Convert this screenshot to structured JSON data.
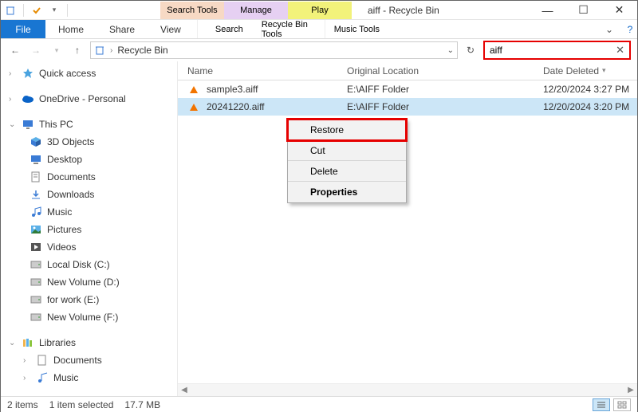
{
  "titlebar": {
    "tool_tabs": {
      "search": "Search Tools",
      "manage": "Manage",
      "play": "Play"
    },
    "title": "aiff - Recycle Bin"
  },
  "ribbon": {
    "file": "File",
    "tabs": [
      "Home",
      "Share",
      "View"
    ],
    "sub_tabs": [
      "Search",
      "Recycle Bin Tools",
      "Music Tools"
    ]
  },
  "address": {
    "crumb": "Recycle Bin"
  },
  "search": {
    "value": "aiff"
  },
  "sidebar": {
    "quick_access": "Quick access",
    "onedrive": "OneDrive - Personal",
    "this_pc": "This PC",
    "items": [
      "3D Objects",
      "Desktop",
      "Documents",
      "Downloads",
      "Music",
      "Pictures",
      "Videos",
      "Local Disk (C:)",
      "New Volume (D:)",
      "for work (E:)",
      "New Volume (F:)"
    ],
    "libraries": "Libraries",
    "lib_items": [
      "Documents",
      "Music"
    ]
  },
  "columns": {
    "name": "Name",
    "location": "Original Location",
    "date": "Date Deleted"
  },
  "files": [
    {
      "name": "sample3.aiff",
      "location": "E:\\AIFF Folder",
      "date": "12/20/2024 3:27 PM"
    },
    {
      "name": "20241220.aiff",
      "location": "E:\\AIFF Folder",
      "date": "12/20/2024 3:20 PM"
    }
  ],
  "context_menu": {
    "restore": "Restore",
    "cut": "Cut",
    "delete": "Delete",
    "properties": "Properties"
  },
  "status": {
    "count": "2 items",
    "selected": "1 item selected",
    "size": "17.7 MB"
  }
}
